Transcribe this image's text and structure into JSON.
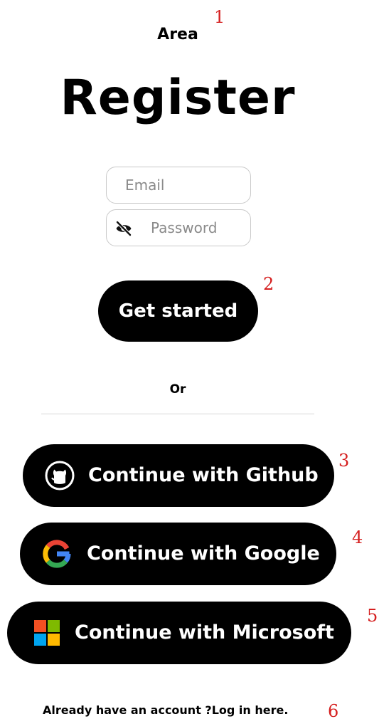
{
  "header": {
    "app_name": "Area",
    "title": "Register"
  },
  "form": {
    "email_placeholder": "Email",
    "email_value": "",
    "password_placeholder": "Password",
    "password_value": "",
    "password_toggle_icon": "eye-off-icon",
    "submit_label": "Get started"
  },
  "separator": {
    "label": "Or"
  },
  "oauth": {
    "github_label": "Continue with Github",
    "github_icon": "github-icon",
    "google_label": "Continue with Google",
    "google_icon": "google-icon",
    "microsoft_label": "Continue with Microsoft",
    "microsoft_icon": "microsoft-icon"
  },
  "footer": {
    "prompt": "Already have an account ?",
    "login_link": "Log in here."
  },
  "annotations": [
    "1",
    "2",
    "3",
    "4",
    "5",
    "6"
  ],
  "colors": {
    "button_bg": "#000000",
    "button_text": "#ffffff",
    "annotation": "#d51f1f",
    "field_border": "#c9c9c9",
    "google_blue": "#4285F4",
    "google_red": "#EA4335",
    "google_yellow": "#FBBC05",
    "google_green": "#34A853",
    "ms_red": "#F25022",
    "ms_green": "#7FBA00",
    "ms_blue": "#00A4EF",
    "ms_yellow": "#FFB900"
  }
}
